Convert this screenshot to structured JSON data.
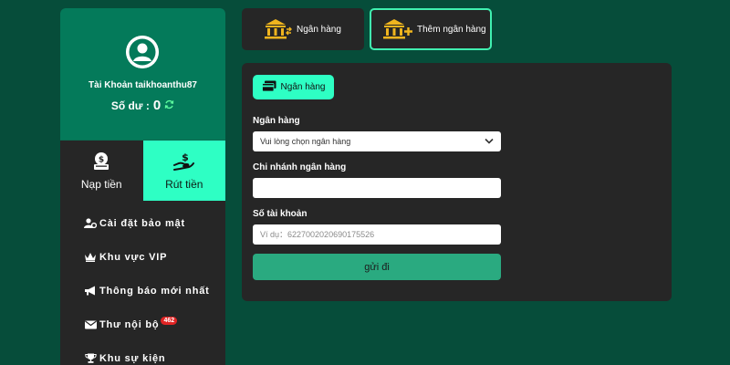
{
  "profile": {
    "account_line": "Tài Khoản taikhoanthu87",
    "balance_label": "Số dư :",
    "balance_value": "0"
  },
  "tabs": {
    "deposit": "Nạp tiền",
    "withdraw": "Rút tiền"
  },
  "menu": [
    {
      "label": "Cài đặt bảo mật",
      "icon": "user-gear-icon"
    },
    {
      "label": "Khu vực VIP",
      "icon": "crown-icon"
    },
    {
      "label": "Thông báo mới nhất",
      "icon": "megaphone-icon"
    },
    {
      "label": "Thư nội bộ",
      "icon": "envelope-icon",
      "badge": "462"
    },
    {
      "label": "Khu sự kiện",
      "icon": "trophy-icon"
    }
  ],
  "top_buttons": {
    "bank": "Ngân hàng",
    "add_bank": "Thêm ngân hàng"
  },
  "form": {
    "chip_label": "Ngân hàng",
    "bank_label": "Ngân hàng",
    "bank_select_value": "Vui lòng chọn ngân hàng",
    "branch_label": "Chi nhánh ngân hàng",
    "branch_value": "",
    "account_label": "Số tài khoản",
    "account_placeholder": "Ví dụ：6227002020690175526",
    "submit_label": "gửi đi"
  },
  "colors": {
    "background": "#064d3a",
    "profile_bg": "#047a5a",
    "accent": "#2effc4",
    "submit": "#2aaa80",
    "panel": "#262626",
    "bank_icon": "#f0b51e",
    "badge": "#e02424"
  }
}
